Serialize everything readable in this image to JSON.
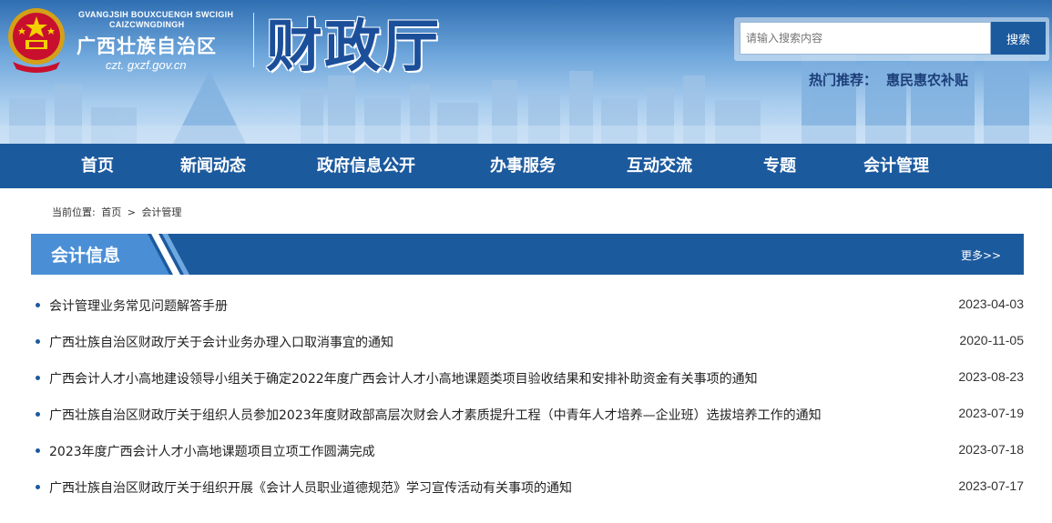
{
  "header": {
    "site_latin_line1": "GVANGJSIH BOUXCUENGH SWCIGIH",
    "site_latin_line2": "CAIZCWNGDINGH",
    "region_name": "广西壮族自治区",
    "domain": "czt. gxzf.gov.cn",
    "department": "财政厅",
    "emblem_icon": "national-emblem-icon"
  },
  "search": {
    "placeholder": "请输入搜索内容",
    "button_label": "搜索"
  },
  "hot": {
    "label": "热门推荐：",
    "link": "惠民惠农补贴"
  },
  "nav": {
    "items": [
      "首页",
      "新闻动态",
      "政府信息公开",
      "办事服务",
      "互动交流",
      "专题",
      "会计管理"
    ]
  },
  "breadcrumb": {
    "label": "当前位置:",
    "home": "首页",
    "separator": ">",
    "current": "会计管理"
  },
  "section": {
    "title": "会计信息",
    "more": "更多>>"
  },
  "articles": [
    {
      "title": "会计管理业务常见问题解答手册",
      "date": "2023-04-03"
    },
    {
      "title": "广西壮族自治区财政厅关于会计业务办理入口取消事宜的通知",
      "date": "2020-11-05"
    },
    {
      "title": "广西会计人才小高地建设领导小组关于确定2022年度广西会计人才小高地课题类项目验收结果和安排补助资金有关事项的通知",
      "date": "2023-08-23"
    },
    {
      "title": "广西壮族自治区财政厅关于组织人员参加2023年度财政部高层次财会人才素质提升工程（中青年人才培养—企业班）选拔培养工作的通知",
      "date": "2023-07-19"
    },
    {
      "title": "2023年度广西会计人才小高地课题项目立项工作圆满完成",
      "date": "2023-07-18"
    },
    {
      "title": "广西壮族自治区财政厅关于组织开展《会计人员职业道德规范》学习宣传活动有关事项的通知",
      "date": "2023-07-17"
    }
  ],
  "colors": {
    "brand_blue": "#1c5a9e",
    "tab_light_blue": "#4a8fd6"
  }
}
